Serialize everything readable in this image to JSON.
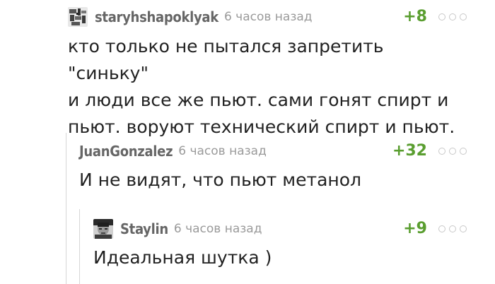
{
  "comments": [
    {
      "author": "staryhshapoklyak",
      "time": "6 часов назад",
      "rating": "+8",
      "text": "кто только не пытался запретить \"синьку\"\nи люди все же пьют. сами гонят спирт и\nпьют. воруют технический спирт и пьют.",
      "avatar_icon": "user-avatar"
    },
    {
      "author": "JuanGonzalez",
      "time": "6 часов назад",
      "rating": "+32",
      "text": "И не видят, что пьют метанол"
    },
    {
      "author": "Staylin",
      "time": "6 часов назад",
      "rating": "+9",
      "text": "Идеальная шутка )",
      "avatar_icon": "user-avatar"
    }
  ],
  "icons": {
    "more": "more-options-icon"
  },
  "colors": {
    "rating_positive": "#5a9e30",
    "author": "#666666",
    "time": "#9a9a9a",
    "text": "#222222",
    "branch_line": "#d6d6d6"
  }
}
